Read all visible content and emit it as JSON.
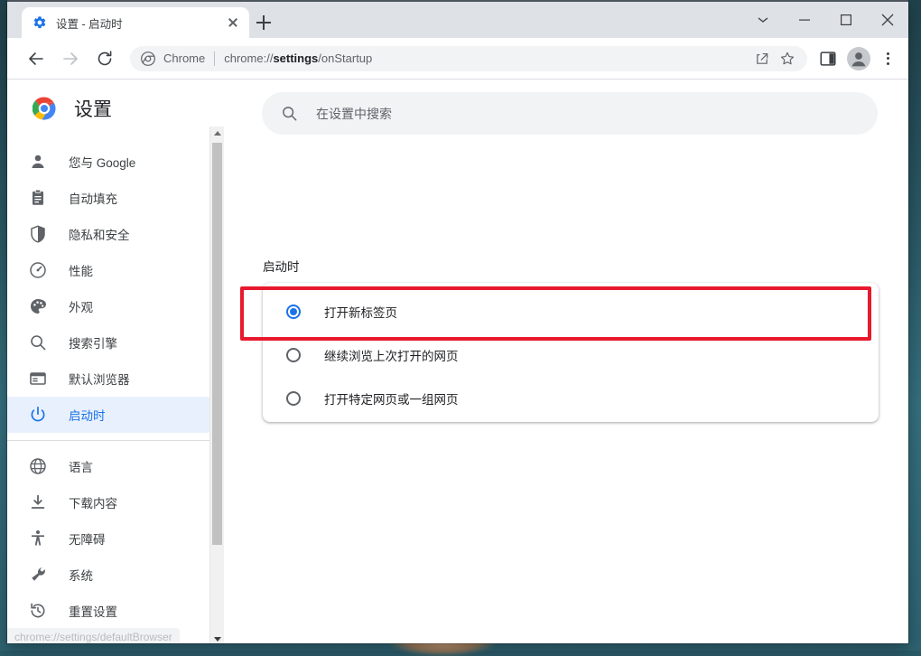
{
  "window": {
    "controls": [
      {
        "name": "tab-search-button",
        "icon": "chevron-down-icon"
      },
      {
        "name": "minimize-button",
        "icon": "minimize-icon"
      },
      {
        "name": "maximize-button",
        "icon": "maximize-icon"
      },
      {
        "name": "close-button",
        "icon": "close-icon"
      }
    ]
  },
  "tabstrip": {
    "tab": {
      "title": "设置 - 启动时",
      "favicon": "settings-gear-icon"
    },
    "new_tab_label": "+"
  },
  "toolbar": {
    "back": "←",
    "forward": "→",
    "reload": "⟳",
    "omnibox": {
      "site_icon": "chrome-logo-icon",
      "chip_label": "Chrome",
      "url_prefix": "chrome://",
      "url_bold": "settings",
      "url_suffix": "/onStartup"
    },
    "actions": [
      "share-icon",
      "bookmark-star-icon"
    ],
    "side_panel": "side-panel-icon",
    "profile": "avatar-icon",
    "menu": "three-dots-menu-icon"
  },
  "sidebar": {
    "brand": {
      "logo": "chrome-logo-icon",
      "title": "设置"
    },
    "groups": [
      {
        "items": [
          {
            "label": "您与 Google",
            "icon": "person-icon",
            "selected": false
          },
          {
            "label": "自动填充",
            "icon": "clipboard-icon",
            "selected": false
          },
          {
            "label": "隐私和安全",
            "icon": "shield-icon",
            "selected": false
          },
          {
            "label": "性能",
            "icon": "speedometer-icon",
            "selected": false
          },
          {
            "label": "外观",
            "icon": "palette-icon",
            "selected": false
          },
          {
            "label": "搜索引擎",
            "icon": "search-icon",
            "selected": false
          },
          {
            "label": "默认浏览器",
            "icon": "browser-window-icon",
            "selected": false
          },
          {
            "label": "启动时",
            "icon": "power-icon",
            "selected": true
          }
        ]
      },
      {
        "items": [
          {
            "label": "语言",
            "icon": "globe-icon",
            "selected": false
          },
          {
            "label": "下载内容",
            "icon": "download-icon",
            "selected": false
          },
          {
            "label": "无障碍",
            "icon": "accessibility-icon",
            "selected": false
          },
          {
            "label": "系统",
            "icon": "wrench-icon",
            "selected": false
          },
          {
            "label": "重置设置",
            "icon": "history-restore-icon",
            "selected": false
          }
        ]
      }
    ],
    "scrollbar": {
      "up": "scroll-up-arrow",
      "down": "scroll-down-arrow"
    }
  },
  "main": {
    "search": {
      "icon": "search-icon",
      "placeholder": "在设置中搜索",
      "value": ""
    },
    "section_title": "启动时",
    "radio_options": [
      {
        "label": "打开新标签页",
        "checked": true
      },
      {
        "label": "继续浏览上次打开的网页",
        "checked": false
      },
      {
        "label": "打开特定网页或一组网页",
        "checked": false
      }
    ]
  },
  "status_bar": {
    "text": "chrome://settings/defaultBrowser"
  },
  "annotation": {
    "color": "#e8192c",
    "target": "打开新标签页"
  }
}
